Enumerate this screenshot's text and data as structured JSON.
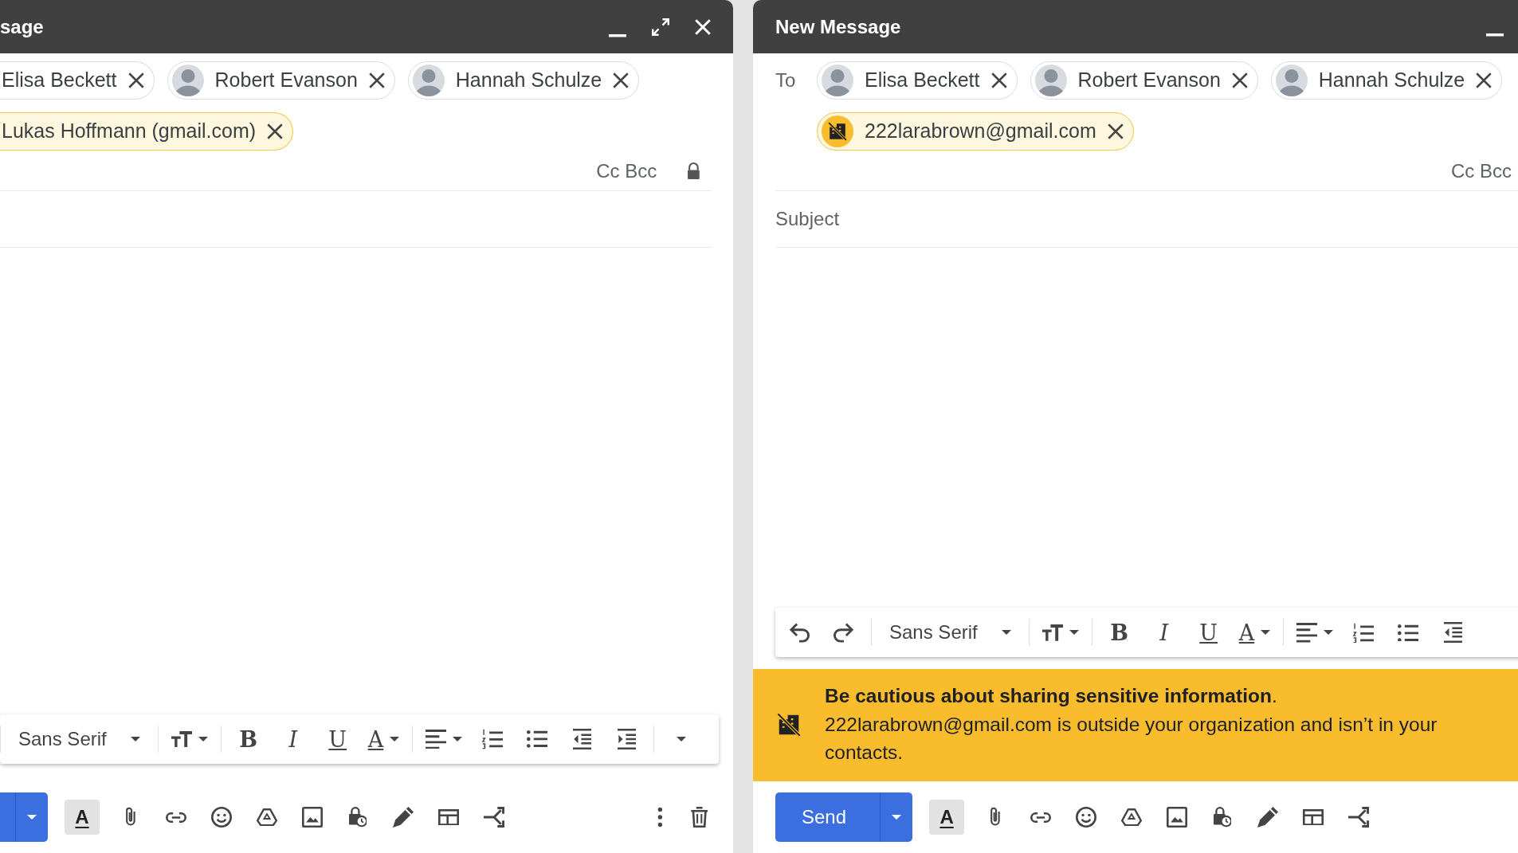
{
  "windows": [
    {
      "title": "sage",
      "header_buttons": [
        {
          "kind": "minimize"
        },
        {
          "kind": "expand"
        },
        {
          "kind": "close"
        }
      ],
      "recipient_rows": [
        [
          {
            "name": "Elisa Beckett",
            "external": false,
            "has_avatar": false
          },
          {
            "name": "Robert Evanson",
            "external": false,
            "has_avatar": true
          },
          {
            "name": "Hannah Schulze",
            "external": false,
            "has_avatar": true
          }
        ],
        [
          {
            "name": "Lukas Hoffmann (gmail.com)",
            "external": true,
            "has_avatar": false
          }
        ]
      ],
      "cc_bcc": "Cc Bcc",
      "lock": true,
      "format_tools": [
        {
          "kind": "separator"
        },
        {
          "kind": "font",
          "label": "Sans Serif"
        },
        {
          "kind": "separator"
        },
        {
          "kind": "size"
        },
        {
          "kind": "separator"
        },
        {
          "kind": "bold",
          "label": "B"
        },
        {
          "kind": "italic",
          "label": "I"
        },
        {
          "kind": "underline",
          "label": "U"
        },
        {
          "kind": "color",
          "label": "A"
        },
        {
          "kind": "separator"
        },
        {
          "kind": "align"
        },
        {
          "kind": "numbered"
        },
        {
          "kind": "bulleted"
        },
        {
          "kind": "outdent"
        },
        {
          "kind": "indent"
        },
        {
          "kind": "separator"
        },
        {
          "kind": "more"
        }
      ],
      "send_button": {
        "cut": true
      },
      "format_toggle": {
        "label": "A",
        "on": true
      },
      "tools": [
        {
          "kind": "attach"
        },
        {
          "kind": "link"
        },
        {
          "kind": "emoji"
        },
        {
          "kind": "drive"
        },
        {
          "kind": "photo"
        },
        {
          "kind": "confidential"
        },
        {
          "kind": "signature"
        },
        {
          "kind": "layout"
        },
        {
          "kind": "shuffle"
        }
      ],
      "end_tools": [
        {
          "kind": "more"
        },
        {
          "kind": "delete"
        }
      ]
    },
    {
      "title": "New Message",
      "header_buttons": [
        {
          "kind": "minimize"
        }
      ],
      "to_label": "To",
      "recipient_rows": [
        [
          {
            "name": "Elisa Beckett",
            "external": false,
            "has_avatar": true
          },
          {
            "name": "Robert Evanson",
            "external": false,
            "has_avatar": true
          },
          {
            "name": "Hannah Schulze",
            "external": false,
            "has_avatar": true
          }
        ],
        [
          {
            "name": "222larabrown@gmail.com",
            "external": true,
            "has_avatar": true
          }
        ]
      ],
      "cc_bcc": "Cc Bcc",
      "subject_placeholder": "Subject",
      "format_tools": [
        {
          "kind": "undo"
        },
        {
          "kind": "redo"
        },
        {
          "kind": "separator"
        },
        {
          "kind": "font",
          "label": "Sans Serif"
        },
        {
          "kind": "separator"
        },
        {
          "kind": "size"
        },
        {
          "kind": "separator"
        },
        {
          "kind": "bold",
          "label": "B"
        },
        {
          "kind": "italic",
          "label": "I"
        },
        {
          "kind": "underline",
          "label": "U"
        },
        {
          "kind": "color",
          "label": "A"
        },
        {
          "kind": "separator"
        },
        {
          "kind": "align"
        },
        {
          "kind": "numbered"
        },
        {
          "kind": "bulleted"
        },
        {
          "kind": "outdent"
        }
      ],
      "warning": {
        "title": "**Be cautious about sharing sensitive information**.",
        "text": "222larabrown@gmail.com is outside your organization and isn’t in your contacts."
      },
      "send_button": {
        "label": "Send",
        "cut": false
      },
      "format_toggle": {
        "label": "A",
        "on": true
      },
      "tools": [
        {
          "kind": "attach"
        },
        {
          "kind": "link"
        },
        {
          "kind": "emoji"
        },
        {
          "kind": "drive"
        },
        {
          "kind": "photo"
        },
        {
          "kind": "confidential"
        },
        {
          "kind": "signature"
        },
        {
          "kind": "layout"
        },
        {
          "kind": "shuffle"
        }
      ]
    }
  ]
}
